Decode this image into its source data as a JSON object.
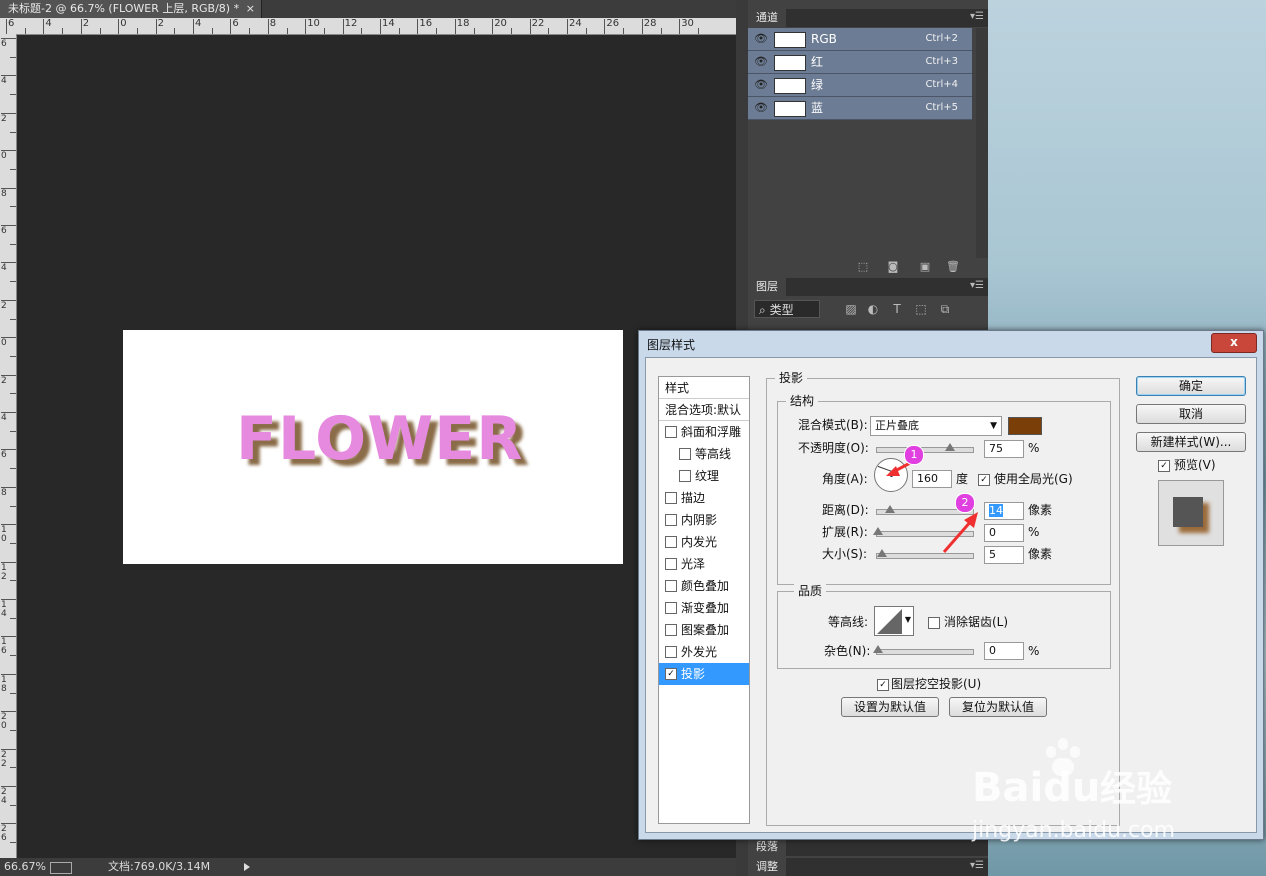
{
  "document_tab": {
    "title": "未标题-2 @ 66.7% (FLOWER 上层, RGB/8) *",
    "close": "×"
  },
  "ruler_h_labels": [
    "6",
    "4",
    "2",
    "0",
    "2",
    "4",
    "6",
    "8",
    "10",
    "12",
    "14",
    "16",
    "18",
    "20",
    "22",
    "24",
    "26",
    "28",
    "30"
  ],
  "ruler_v_labels": [
    "6",
    "4",
    "2",
    "0",
    "8",
    "6",
    "4",
    "2",
    "0",
    "2",
    "4",
    "6",
    "8",
    "10",
    "12",
    "14",
    "16",
    "18",
    "20",
    "22",
    "24",
    "26"
  ],
  "canvas": {
    "text": "FLOWER"
  },
  "status": {
    "zoom": "66.67%",
    "doc": "文档:769.0K/3.14M"
  },
  "channels_panel": {
    "tab": "通道",
    "rows": [
      {
        "name": "RGB",
        "shortcut": "Ctrl+2"
      },
      {
        "name": "红",
        "shortcut": "Ctrl+3"
      },
      {
        "name": "绿",
        "shortcut": "Ctrl+4"
      },
      {
        "name": "蓝",
        "shortcut": "Ctrl+5"
      }
    ]
  },
  "layers_panel": {
    "tab": "图层",
    "filter": "类型"
  },
  "bottom_tabs": {
    "paragraph": "段落",
    "adjust": "调整"
  },
  "dialog": {
    "title": "图层样式",
    "close": "x",
    "style_list": {
      "header": "样式",
      "blend": "混合选项:默认",
      "items": [
        {
          "label": "斜面和浮雕",
          "checked": false
        },
        {
          "label": "等高线",
          "checked": false
        },
        {
          "label": "纹理",
          "checked": false
        },
        {
          "label": "描边",
          "checked": false
        },
        {
          "label": "内阴影",
          "checked": false
        },
        {
          "label": "内发光",
          "checked": false
        },
        {
          "label": "光泽",
          "checked": false
        },
        {
          "label": "颜色叠加",
          "checked": false
        },
        {
          "label": "渐变叠加",
          "checked": false
        },
        {
          "label": "图案叠加",
          "checked": false
        },
        {
          "label": "外发光",
          "checked": false
        },
        {
          "label": "投影",
          "checked": true
        }
      ]
    },
    "section_title": "投影",
    "structure": {
      "label": "结构",
      "blend_mode_label": "混合模式(B):",
      "blend_mode_value": "正片叠底",
      "shadow_color": "#7a3e08",
      "opacity_label": "不透明度(O):",
      "opacity_value": "75",
      "opacity_unit": "%",
      "angle_label": "角度(A):",
      "angle_value": "160",
      "angle_unit": "度",
      "global_light_label": "使用全局光(G)",
      "distance_label": "距离(D):",
      "distance_value": "14",
      "distance_unit": "像素",
      "spread_label": "扩展(R):",
      "spread_value": "0",
      "spread_unit": "%",
      "size_label": "大小(S):",
      "size_value": "5",
      "size_unit": "像素"
    },
    "quality": {
      "label": "品质",
      "contour_label": "等高线:",
      "antialias_label": "消除锯齿(L)",
      "noise_label": "杂色(N):",
      "noise_value": "0",
      "noise_unit": "%"
    },
    "knockout_label": "图层挖空投影(U)",
    "set_default": "设置为默认值",
    "reset_default": "复位为默认值",
    "ok": "确定",
    "cancel": "取消",
    "new_style": "新建样式(W)...",
    "preview_label": "预览(V)"
  },
  "annotations": {
    "badge1": "1",
    "badge2": "2",
    "accent": "#e040e0"
  },
  "watermark": {
    "brand": "Bai",
    "brand2": "du",
    "cn": "经验",
    "url": "jingyan.baidu.com"
  }
}
